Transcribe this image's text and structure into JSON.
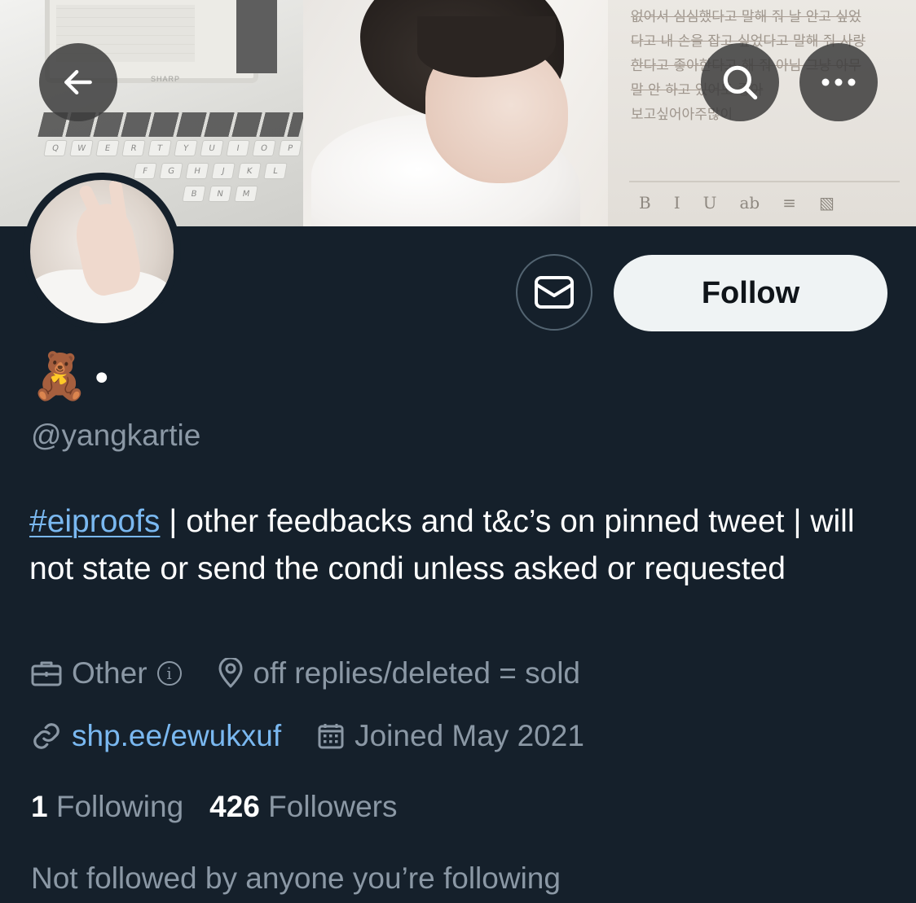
{
  "banner": {
    "device_logo": "SHARP",
    "keyboard_row1": [
      "Q",
      "W",
      "E",
      "R",
      "T",
      "Y",
      "U",
      "I",
      "O",
      "P"
    ],
    "keyboard_row2": [
      "F",
      "G",
      "H",
      "J",
      "K",
      "L"
    ],
    "keyboard_row3": [
      "B",
      "N",
      "M"
    ],
    "note_lines": [
      "없어서 심심했다고 말해 줘 날 안고 싶었",
      "다고 내 손을 잡고 싶었다고 말해 줘 사랑",
      "한다고 좋아한다고 해 줘 아님 그냥 아무",
      "말 안 하고 있어도 좋아",
      "보고싶어아주많이"
    ],
    "note_toolbar": [
      "B",
      "I",
      "U",
      "ab",
      "≡",
      "▧"
    ]
  },
  "nav": {
    "back_icon": "arrow-left-icon",
    "search_icon": "search-icon",
    "more_icon": "more-horizontal-icon"
  },
  "profile": {
    "display_name_emoji": "🧸",
    "display_name_dot": "•",
    "handle": "@yangkartie",
    "bio_hashtag": "#eiproofs",
    "bio_text": " | other feedbacks and t&c’s on pinned tweet | will not state or send the condi unless asked or requested",
    "category": "Other",
    "category_info": "i",
    "location": "off replies/deleted = sold",
    "link": "shp.ee/ewukxuf",
    "joined": "Joined May 2021",
    "following_count": "1",
    "following_label": "Following",
    "followers_count": "426",
    "followers_label": "Followers",
    "followed_by": "Not followed by anyone you’re following"
  },
  "actions": {
    "message_icon": "mail-icon",
    "follow_label": "Follow"
  },
  "colors": {
    "background": "#15202b",
    "secondary_text": "#8b98a5",
    "link": "#7ab8f0",
    "follow_button_bg": "#eff3f4"
  }
}
